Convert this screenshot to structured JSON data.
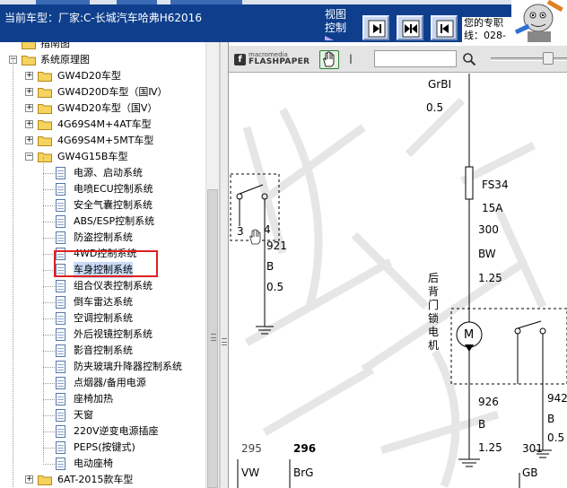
{
  "header": {
    "car_model": "当前车型：厂家:C-长城汽车哈弗H62016",
    "view_control_line1": "视图",
    "view_control_line2": "控制",
    "service_line1": "您的专职",
    "service_line2": "线：028-"
  },
  "nav_buttons": [
    {
      "icon": "arrow-right-icon"
    },
    {
      "icon": "expand-both-icon"
    },
    {
      "icon": "arrow-left-icon"
    }
  ],
  "tree": {
    "partial_top": "指南图",
    "root": "系统原理图",
    "models": [
      "GW4D20车型",
      "GW4D20D车型（国Ⅳ）",
      "GW4D20车型（国Ⅴ）",
      "4G69S4M+4AT车型",
      "4G69S4M+5MT车型",
      "GW4G15B车型"
    ],
    "systems": [
      "电源、启动系统",
      "电喷ECU控制系统",
      "安全气囊控制系统",
      "ABS/ESP控制系统",
      "防盗控制系统",
      "4WD控制系统",
      "车身控制系统",
      "组合仪表控制系统",
      "倒车雷达系统",
      "空调控制系统",
      "外后视镜控制系统",
      "影音控制系统",
      "防夹玻璃升降器控制系统",
      "点烟器/备用电源",
      "座椅加热",
      "天窗",
      "220V逆变电源插座",
      "PEPS(按键式)",
      "电动座椅"
    ],
    "selected_index": 6,
    "last_model": "6AT-2015款车型"
  },
  "viewer": {
    "logo_top": "macromedia",
    "logo_bottom": "FLASHPAPER",
    "find_value": ""
  },
  "diagram": {
    "labels": {
      "grbi": "GrBI",
      "size_05_top": "0.5",
      "fuse": "FS34",
      "fuse_amps": "15A",
      "wire_300": "300",
      "color_bw": "BW",
      "size_125_top": "1.25",
      "pin_3": "3",
      "pin_4": "4",
      "wire_921": "921",
      "color_b_left": "B",
      "size_05_left": "0.5",
      "motor": "M",
      "motor_name": "后背门锁电机",
      "wire_926": "926",
      "color_b_mid": "B",
      "size_125_mid": "1.25",
      "wire_942": "942",
      "color_b_right": "B",
      "size_05_right": "0.5",
      "wire_295": "295",
      "color_vw": "VW",
      "wire_296": "296",
      "color_brg": "BrG",
      "wire_301": "301",
      "color_gb": "GB"
    }
  },
  "colors": {
    "header_bg": "#0f3f8c",
    "highlight": "#e02020",
    "selection": "#c8dcf7"
  }
}
